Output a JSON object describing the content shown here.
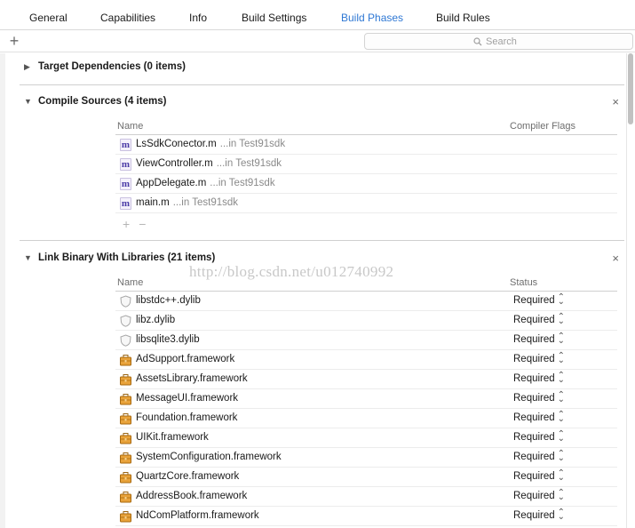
{
  "tabs": [
    {
      "label": "General",
      "active": false
    },
    {
      "label": "Capabilities",
      "active": false
    },
    {
      "label": "Info",
      "active": false
    },
    {
      "label": "Build Settings",
      "active": false
    },
    {
      "label": "Build Phases",
      "active": true
    },
    {
      "label": "Build Rules",
      "active": false
    }
  ],
  "toolbar": {
    "add_symbol": "+",
    "search_placeholder": "Search",
    "search_icon": "search-icon"
  },
  "phases": {
    "target_dependencies": {
      "title": "Target Dependencies (0 items)",
      "expanded": false
    },
    "compile_sources": {
      "title": "Compile Sources (4 items)",
      "expanded": true,
      "col_name": "Name",
      "col_flags": "Compiler Flags",
      "files": [
        {
          "name": "LsSdkConector.m",
          "location": "...in Test91sdk",
          "icon": "objc-m-file-icon"
        },
        {
          "name": "ViewController.m",
          "location": "...in Test91sdk",
          "icon": "objc-m-file-icon"
        },
        {
          "name": "AppDelegate.m",
          "location": "...in Test91sdk",
          "icon": "objc-m-file-icon"
        },
        {
          "name": "main.m",
          "location": "...in Test91sdk",
          "icon": "objc-m-file-icon"
        }
      ],
      "add_symbol": "+",
      "remove_symbol": "−"
    },
    "link_binary": {
      "title": "Link Binary With Libraries (21 items)",
      "expanded": true,
      "col_name": "Name",
      "col_status": "Status",
      "libraries": [
        {
          "name": "libstdc++.dylib",
          "status": "Required",
          "icon": "dylib-shield-icon"
        },
        {
          "name": "libz.dylib",
          "status": "Required",
          "icon": "dylib-shield-icon"
        },
        {
          "name": "libsqlite3.dylib",
          "status": "Required",
          "icon": "dylib-shield-icon"
        },
        {
          "name": "AdSupport.framework",
          "status": "Required",
          "icon": "framework-toolbox-icon"
        },
        {
          "name": "AssetsLibrary.framework",
          "status": "Required",
          "icon": "framework-toolbox-icon"
        },
        {
          "name": "MessageUI.framework",
          "status": "Required",
          "icon": "framework-toolbox-icon"
        },
        {
          "name": "Foundation.framework",
          "status": "Required",
          "icon": "framework-toolbox-icon"
        },
        {
          "name": "UIKit.framework",
          "status": "Required",
          "icon": "framework-toolbox-icon"
        },
        {
          "name": "SystemConfiguration.framework",
          "status": "Required",
          "icon": "framework-toolbox-icon"
        },
        {
          "name": "QuartzCore.framework",
          "status": "Required",
          "icon": "framework-toolbox-icon"
        },
        {
          "name": "AddressBook.framework",
          "status": "Required",
          "icon": "framework-toolbox-icon"
        },
        {
          "name": "NdComPlatform.framework",
          "status": "Required",
          "icon": "framework-toolbox-icon"
        }
      ]
    }
  },
  "close_symbol": "×",
  "watermark": "http://blog.csdn.net/u012740992",
  "colors": {
    "active_tab": "#2f78d4",
    "framework_icon": "#e8a23a"
  }
}
